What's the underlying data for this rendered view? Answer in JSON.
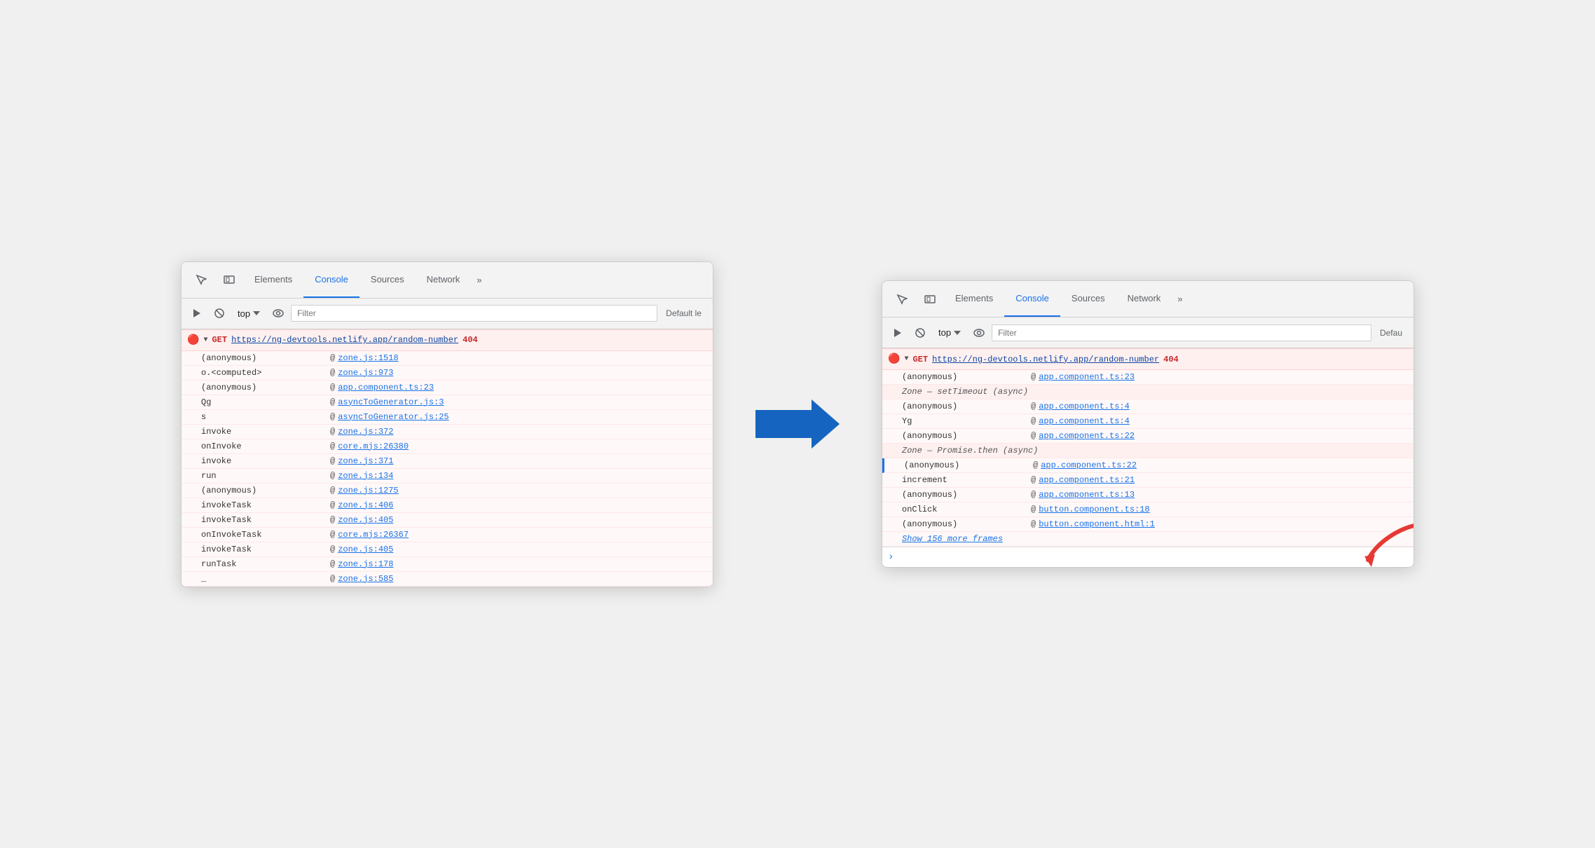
{
  "left_panel": {
    "tabs": {
      "elements": "Elements",
      "console": "Console",
      "sources": "Sources",
      "network": "Network",
      "more": "»"
    },
    "toolbar": {
      "top_label": "top",
      "filter_placeholder": "Filter",
      "default_label": "Default le"
    },
    "error": {
      "method": "GET",
      "url": "https://ng-devtools.netlify.app/random-number",
      "code": "404"
    },
    "stack_frames": [
      {
        "func": "(anonymous)",
        "at": "@",
        "link": "zone.js:1518"
      },
      {
        "func": "o.<computed>",
        "at": "@",
        "link": "zone.js:973"
      },
      {
        "func": "(anonymous)",
        "at": "@",
        "link": "app.component.ts:23"
      },
      {
        "func": "Qg",
        "at": "@",
        "link": "asyncToGenerator.js:3"
      },
      {
        "func": "s",
        "at": "@",
        "link": "asyncToGenerator.js:25"
      },
      {
        "func": "invoke",
        "at": "@",
        "link": "zone.js:372"
      },
      {
        "func": "onInvoke",
        "at": "@",
        "link": "core.mjs:26380"
      },
      {
        "func": "invoke",
        "at": "@",
        "link": "zone.js:371"
      },
      {
        "func": "run",
        "at": "@",
        "link": "zone.js:134"
      },
      {
        "func": "(anonymous)",
        "at": "@",
        "link": "zone.js:1275"
      },
      {
        "func": "invokeTask",
        "at": "@",
        "link": "zone.js:406"
      },
      {
        "func": "invokeTask",
        "at": "@",
        "link": "zone.js:405"
      },
      {
        "func": "onInvokeTask",
        "at": "@",
        "link": "core.mjs:26367"
      },
      {
        "func": "invokeTask",
        "at": "@",
        "link": "zone.js:405"
      },
      {
        "func": "runTask",
        "at": "@",
        "link": "zone.js:178"
      },
      {
        "func": "_",
        "at": "@",
        "link": "zone.js:585"
      }
    ]
  },
  "right_panel": {
    "tabs": {
      "elements": "Elements",
      "console": "Console",
      "sources": "Sources",
      "network": "Network",
      "more": "»"
    },
    "toolbar": {
      "top_label": "top",
      "filter_placeholder": "Filter",
      "default_label": "Defau"
    },
    "error": {
      "method": "GET",
      "url": "https://ng-devtools.netlify.app/random-number",
      "code": "404"
    },
    "stack_frames": [
      {
        "type": "normal",
        "func": "(anonymous)",
        "at": "@",
        "link": "app.component.ts:23"
      },
      {
        "type": "async_header",
        "text": "Zone — setTimeout (async)"
      },
      {
        "type": "normal",
        "func": "(anonymous)",
        "at": "@",
        "link": "app.component.ts:4"
      },
      {
        "type": "normal",
        "func": "Yg",
        "at": "@",
        "link": "app.component.ts:4"
      },
      {
        "type": "normal",
        "func": "(anonymous)",
        "at": "@",
        "link": "app.component.ts:22"
      },
      {
        "type": "async_header",
        "text": "Zone — Promise.then (async)"
      },
      {
        "type": "normal",
        "func": "(anonymous)",
        "at": "@",
        "link": "app.component.ts:22"
      },
      {
        "type": "normal",
        "func": "increment",
        "at": "@",
        "link": "app.component.ts:21"
      },
      {
        "type": "normal",
        "func": "(anonymous)",
        "at": "@",
        "link": "app.component.ts:13"
      },
      {
        "type": "normal",
        "func": "onClick",
        "at": "@",
        "link": "button.component.ts:18"
      },
      {
        "type": "normal",
        "func": "(anonymous)",
        "at": "@",
        "link": "button.component.html:1"
      },
      {
        "type": "show_more",
        "text": "Show 156 more frames"
      }
    ]
  }
}
